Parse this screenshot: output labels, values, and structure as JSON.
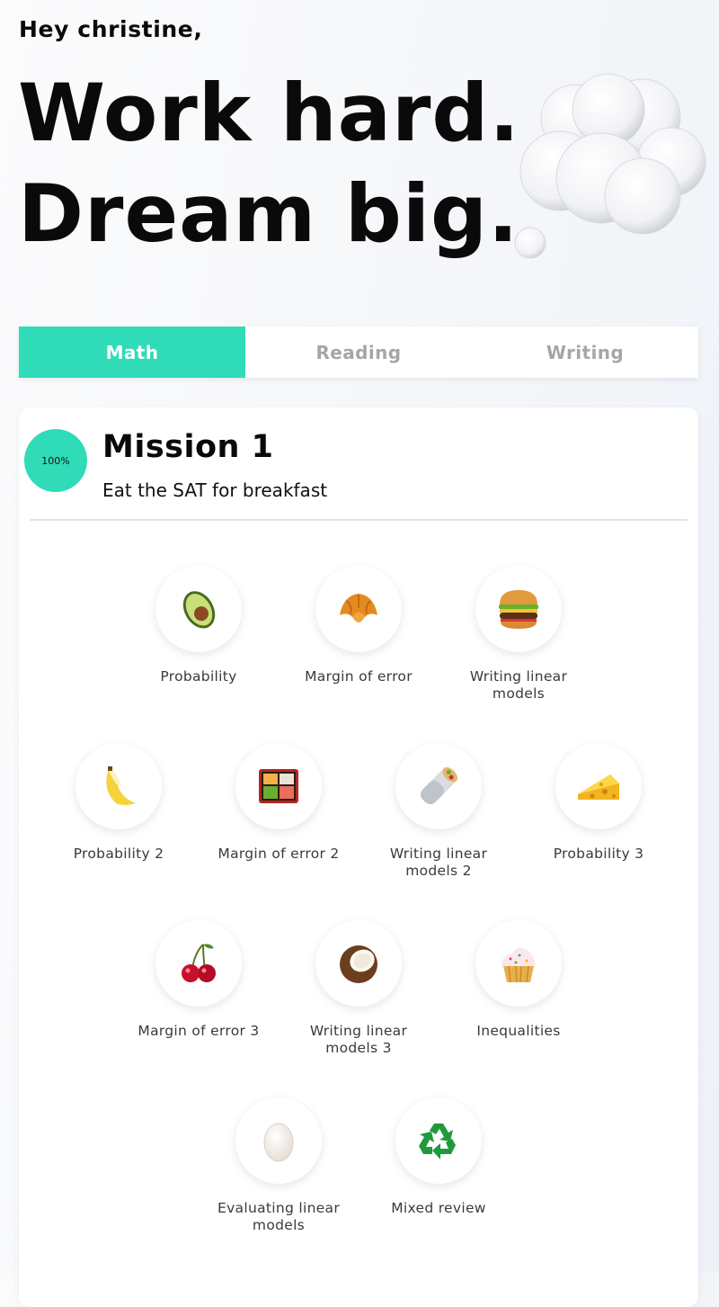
{
  "header": {
    "greeting": "Hey christine,",
    "headline_line1": "Work hard.",
    "headline_line2": "Dream big."
  },
  "tabs": [
    {
      "label": "Math",
      "active": true
    },
    {
      "label": "Reading",
      "active": false
    },
    {
      "label": "Writing",
      "active": false
    }
  ],
  "mission": {
    "progress": "100%",
    "title": "Mission 1",
    "subtitle": "Eat the SAT for breakfast",
    "accent_color": "#30dbb8"
  },
  "lessons": [
    {
      "label": "Probability",
      "icon": "avocado-icon"
    },
    {
      "label": "Margin of error",
      "icon": "croissant-icon"
    },
    {
      "label": "Writing linear models",
      "icon": "hamburger-icon"
    },
    {
      "label": "Probability 2",
      "icon": "banana-icon"
    },
    {
      "label": "Margin of error 2",
      "icon": "bento-box-icon"
    },
    {
      "label": "Writing linear models 2",
      "icon": "burrito-icon"
    },
    {
      "label": "Probability 3",
      "icon": "cheese-icon"
    },
    {
      "label": "Margin of error 3",
      "icon": "cherries-icon"
    },
    {
      "label": "Writing linear models 3",
      "icon": "coconut-icon"
    },
    {
      "label": "Inequalities",
      "icon": "cupcake-icon"
    },
    {
      "label": "Evaluating linear models",
      "icon": "egg-icon"
    },
    {
      "label": "Mixed review",
      "icon": "recycle-icon"
    }
  ]
}
